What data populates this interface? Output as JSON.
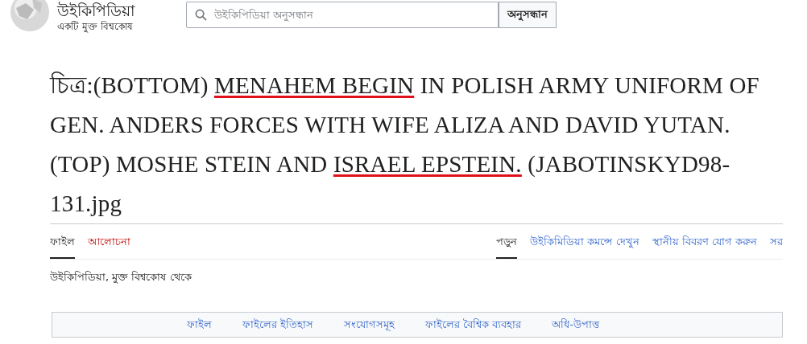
{
  "header": {
    "site_name": "উইকিপিডিয়া",
    "tagline": "একটি মুক্ত বিশ্বকোষ",
    "search": {
      "placeholder": "উইকিপিডিয়া অনুসন্ধান",
      "button": "অনুসন্ধান"
    }
  },
  "title": [
    {
      "text": "চিত্র:(BOTTOM) ",
      "marked": false
    },
    {
      "text": "MENAHEM BEGIN",
      "marked": true
    },
    {
      "text": " IN POLISH ARMY UNIFORM OF GEN. ANDERS FORCES WITH WIFE ALIZA AND DAVID YUTAN. (TOP) MOSHE STEIN AND ",
      "marked": false
    },
    {
      "text": "ISRAEL EPSTEIN.",
      "marked": true
    },
    {
      "text": " (JABOTINSKYD98-131.jpg",
      "marked": false
    }
  ],
  "left_tabs": [
    {
      "label": "ফাইল",
      "selected": true,
      "missing": false
    },
    {
      "label": "আলোচনা",
      "selected": false,
      "missing": true
    }
  ],
  "right_tabs": [
    {
      "label": "পড়ুন",
      "selected": true
    },
    {
      "label": "উইকিমিডিয়া কমন্সে দেখুন",
      "selected": false
    },
    {
      "label": "স্থানীয় বিবরণ যোগ করুন",
      "selected": false
    },
    {
      "label": "সর",
      "selected": false
    }
  ],
  "from_line": "উইকিপিডিয়া, মুক্ত বিশ্বকোষ থেকে",
  "file_nav": [
    "ফাইল",
    "ফাইলের ইতিহাস",
    "সংযোগসমূহ",
    "ফাইলের বৈশ্বিক ব্যবহার",
    "অধি-উপাত্ত"
  ]
}
